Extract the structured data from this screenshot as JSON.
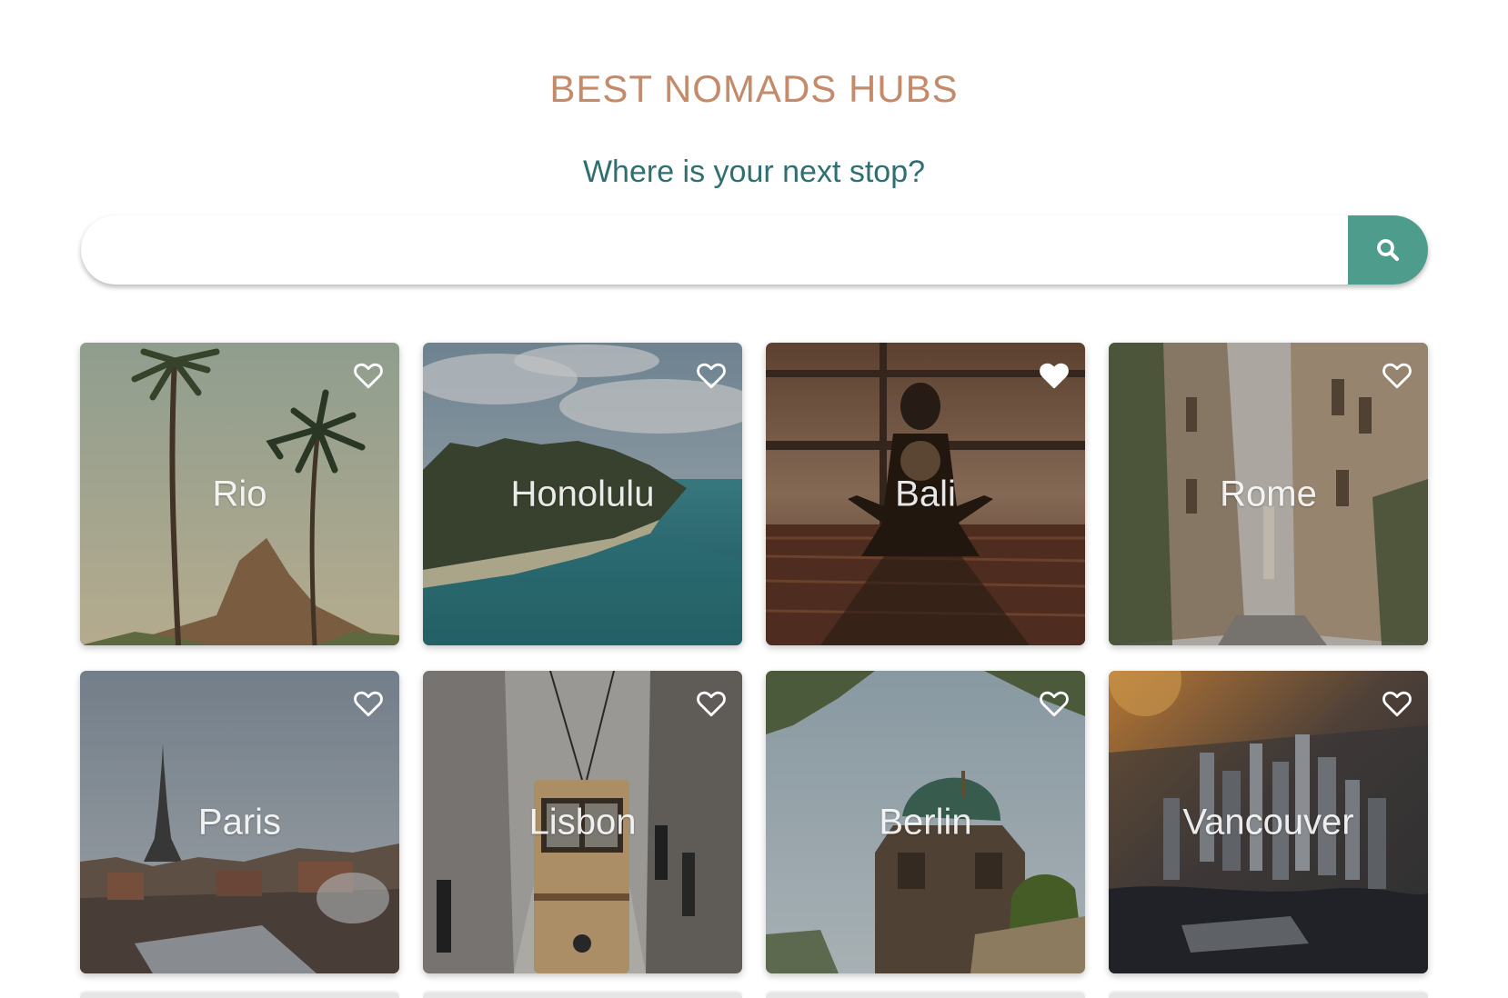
{
  "header": {
    "title": "BEST NOMADS HUBS",
    "subtitle": "Where is your next stop?"
  },
  "search": {
    "value": "",
    "placeholder": "",
    "button_icon": "search-icon",
    "button_color": "#4e9c8c"
  },
  "colors": {
    "title": "#c58a6a",
    "subtitle": "#2f6f72",
    "accent": "#4e9c8c"
  },
  "cities": [
    {
      "name": "Rio",
      "favorited": false,
      "icon": "heart-outline-icon"
    },
    {
      "name": "Honolulu",
      "favorited": false,
      "icon": "heart-outline-icon"
    },
    {
      "name": "Bali",
      "favorited": true,
      "icon": "heart-filled-icon"
    },
    {
      "name": "Rome",
      "favorited": false,
      "icon": "heart-outline-icon"
    },
    {
      "name": "Paris",
      "favorited": false,
      "icon": "heart-outline-icon"
    },
    {
      "name": "Lisbon",
      "favorited": false,
      "icon": "heart-outline-icon"
    },
    {
      "name": "Berlin",
      "favorited": false,
      "icon": "heart-outline-icon"
    },
    {
      "name": "Vancouver",
      "favorited": false,
      "icon": "heart-outline-icon"
    }
  ]
}
